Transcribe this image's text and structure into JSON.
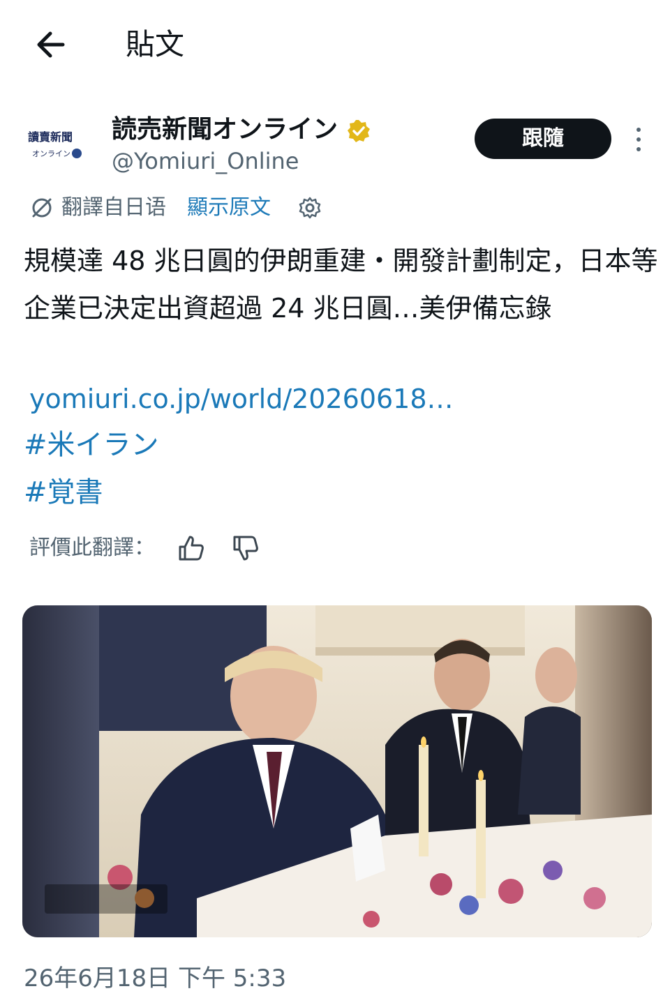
{
  "header": {
    "title": "貼文",
    "back_icon": "arrow-left-icon"
  },
  "author": {
    "avatar_text_top": "讀賣新聞",
    "avatar_text_bottom": "オンライン",
    "display_name": "読売新聞オンライン",
    "handle": "@Yomiuri_Online",
    "verified_color": "#e2b719",
    "follow_label": "跟隨",
    "more_icon": "more-vertical-icon"
  },
  "translation": {
    "translated_from": "翻譯自日语",
    "show_original": "顯示原文",
    "settings_icon": "gear-icon",
    "rate_label": "評價此翻譯：",
    "thumb_up_icon": "thumb-up-icon",
    "thumb_down_icon": "thumb-down-icon"
  },
  "post": {
    "text": "規模達 48 兆日圓的伊朗重建・開發計劃制定，日本等企業已決定出資超過 24 兆日圓…美伊備忘錄",
    "link": "yomiuri.co.jp/world/20260618…",
    "hashtags": [
      "#米イラン",
      "#覚書"
    ],
    "timestamp": "26年6月18日 下午 5:33"
  },
  "colors": {
    "link": "#1a79b8",
    "secondary_text": "#536471",
    "button_bg": "#0f1419"
  }
}
